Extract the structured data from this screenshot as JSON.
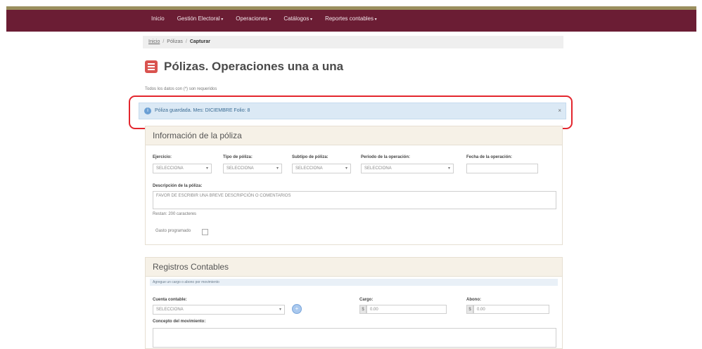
{
  "nav": {
    "items": [
      {
        "label": "Inicio",
        "dropdown": false
      },
      {
        "label": "Gestión Electoral",
        "dropdown": true
      },
      {
        "label": "Operaciones",
        "dropdown": true
      },
      {
        "label": "Catálogos",
        "dropdown": true
      },
      {
        "label": "Reportes contables",
        "dropdown": true
      }
    ]
  },
  "breadcrumb": {
    "home": "Inicio",
    "section": "Pólizas",
    "current": "Capturar"
  },
  "page": {
    "title": "Pólizas. Operaciones una a una",
    "hint": "Todos los datos con (*) son requeridos"
  },
  "alert": {
    "message": "Póliza guardada. Mes: DICIEMBRE Folio: 8",
    "close": "×"
  },
  "poliza": {
    "heading": "Información de la póliza",
    "ejercicio_label": "Ejercicio:",
    "tipo_label": "Tipo de póliza:",
    "subtipo_label": "Subtipo de póliza:",
    "periodo_label": "Periodo de la operación:",
    "fecha_label": "Fecha de la operación:",
    "select_value": "SELECCIONA",
    "descripcion_label": "Descripción de la póliza:",
    "descripcion_placeholder": "FAVOR DE ESCRIBIR UNA BREVE DESCRIPCIÓN O COMENTARIOS",
    "restan": "Restan: 200 caracteres",
    "gasto_label": "Gasto programado"
  },
  "registros": {
    "heading": "Registros Contables",
    "subheading": "Agregue un cargo o abono por movimiento",
    "cuenta_label": "Cuenta contable:",
    "cuenta_value": "SELECCIONA",
    "cargo_label": "Cargo:",
    "abono_label": "Abono:",
    "currency": "$",
    "amount_placeholder": "0.00",
    "concepto_label": "Concepto del movimiento:",
    "add_icon": "+"
  }
}
